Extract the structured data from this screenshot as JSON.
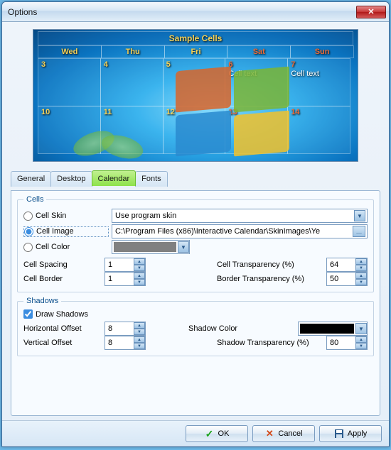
{
  "window": {
    "title": "Options"
  },
  "preview": {
    "title": "Sample Cells",
    "headers": [
      {
        "label": "Wed",
        "kind": "wd"
      },
      {
        "label": "Thu",
        "kind": "wd"
      },
      {
        "label": "Fri",
        "kind": "wd"
      },
      {
        "label": "Sat",
        "kind": "we"
      },
      {
        "label": "Sun",
        "kind": "we"
      }
    ],
    "rows": [
      [
        {
          "n": "3",
          "k": "wd"
        },
        {
          "n": "4",
          "k": "wd"
        },
        {
          "n": "5",
          "k": "wd"
        },
        {
          "n": "6",
          "k": "we",
          "t": "Cell text"
        },
        {
          "n": "7",
          "k": "we",
          "t": "Cell text"
        }
      ],
      [
        {
          "n": "10",
          "k": "wd"
        },
        {
          "n": "11",
          "k": "wd"
        },
        {
          "n": "12",
          "k": "wd"
        },
        {
          "n": "13",
          "k": "we"
        },
        {
          "n": "14",
          "k": "we"
        }
      ]
    ]
  },
  "tabs": [
    "General",
    "Desktop",
    "Calendar",
    "Fonts"
  ],
  "active_tab": 2,
  "cells": {
    "legend": "Cells",
    "skin_label": "Cell Skin",
    "image_label": "Cell Image",
    "color_label": "Cell Color",
    "selected": "image",
    "skin_value": "Use program skin",
    "image_value": "C:\\Program Files (x86)\\Interactive Calendar\\SkinImages\\Ye",
    "color_value": "#808080",
    "spacing_label": "Cell Spacing",
    "spacing_value": "1",
    "border_label": "Cell Border",
    "border_value": "1",
    "transp_label": "Cell Transparency (%)",
    "transp_value": "64",
    "border_transp_label": "Border Transparency (%)",
    "border_transp_value": "50"
  },
  "shadows": {
    "legend": "Shadows",
    "draw_label": "Draw Shadows",
    "draw_checked": true,
    "hoff_label": "Horizontal Offset",
    "hoff_value": "8",
    "voff_label": "Vertical Offset",
    "voff_value": "8",
    "color_label": "Shadow Color",
    "color_value": "#000000",
    "transp_label": "Shadow Transparency (%)",
    "transp_value": "80"
  },
  "buttons": {
    "ok": "OK",
    "cancel": "Cancel",
    "apply": "Apply"
  }
}
